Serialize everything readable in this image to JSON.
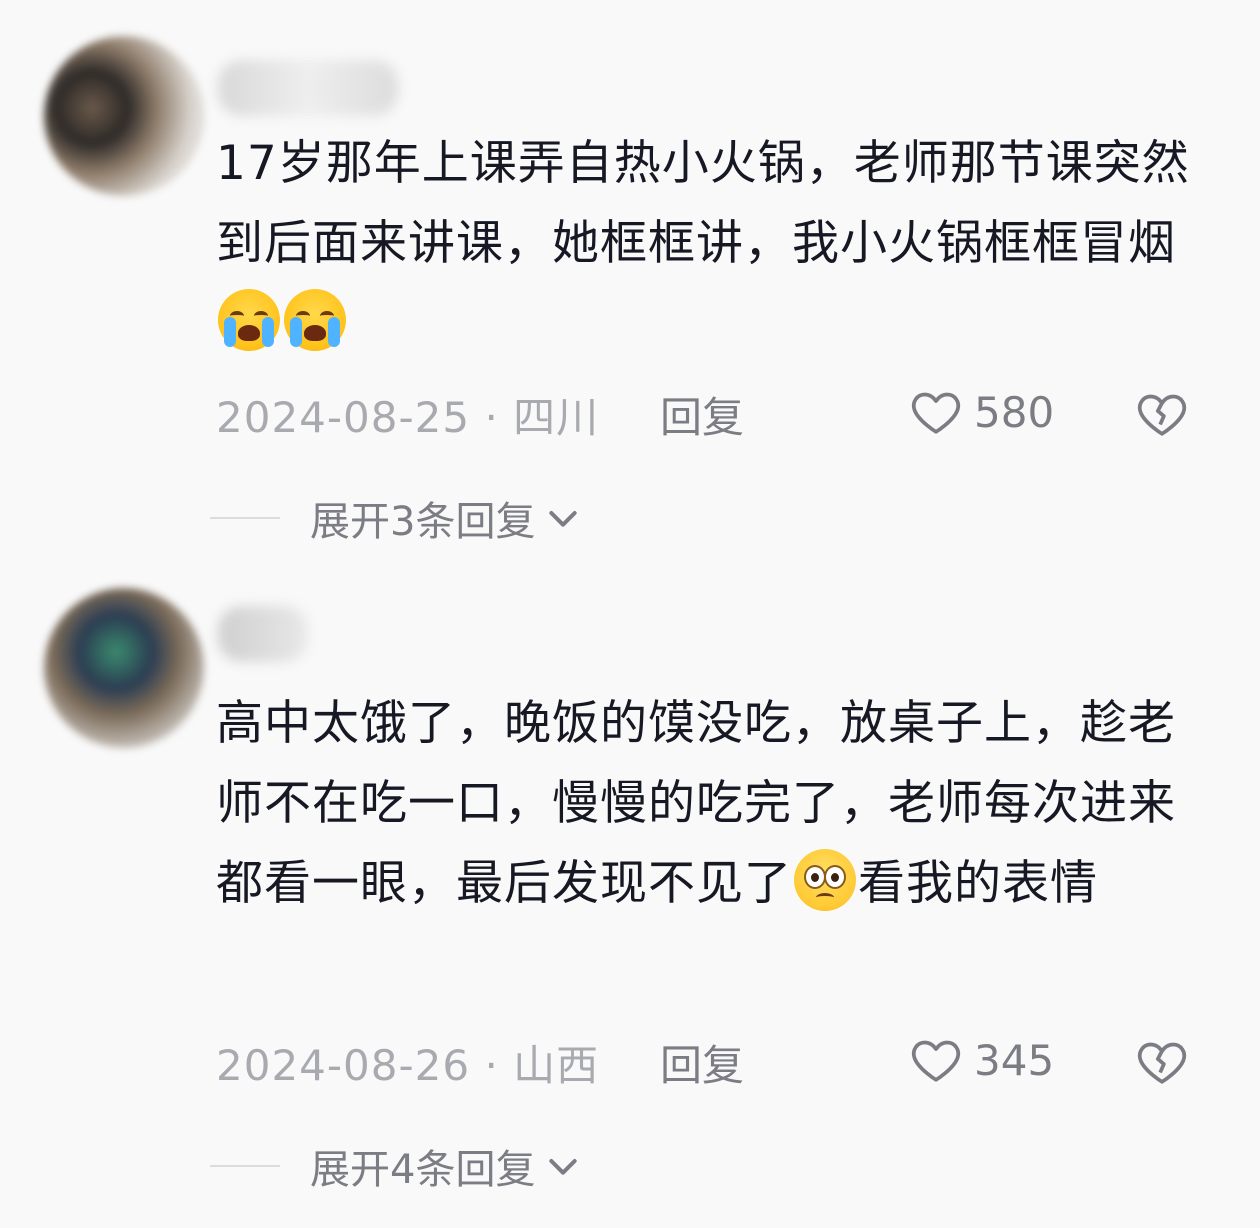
{
  "comments": [
    {
      "text_before": "17岁那年上课弄自热小火锅，老师那节课突然到后面来讲课，她框框讲，我小火锅框框冒烟",
      "emojis": [
        "loudly-crying-face",
        "loudly-crying-face"
      ],
      "text_after": "",
      "date": "2024-08-25",
      "separator": "·",
      "location": "四川",
      "reply_label": "回复",
      "likes": "580",
      "expand_label": "展开3条回复"
    },
    {
      "text_before": "高中太饿了，晚饭的馍没吃，放桌子上，趁老师不在吃一口，慢慢的吃完了，老师每次进来都看一眼，最后发现不见了",
      "emojis": [
        "flushed-face"
      ],
      "text_after": "看我的表情",
      "date": "2024-08-26",
      "separator": "·",
      "location": "山西",
      "reply_label": "回复",
      "likes": "345",
      "expand_label": "展开4条回复"
    }
  ],
  "colors": {
    "background": "#f9f9f9",
    "text": "#161823",
    "muted": "#a9aab0",
    "secondary": "#7c7d84"
  }
}
